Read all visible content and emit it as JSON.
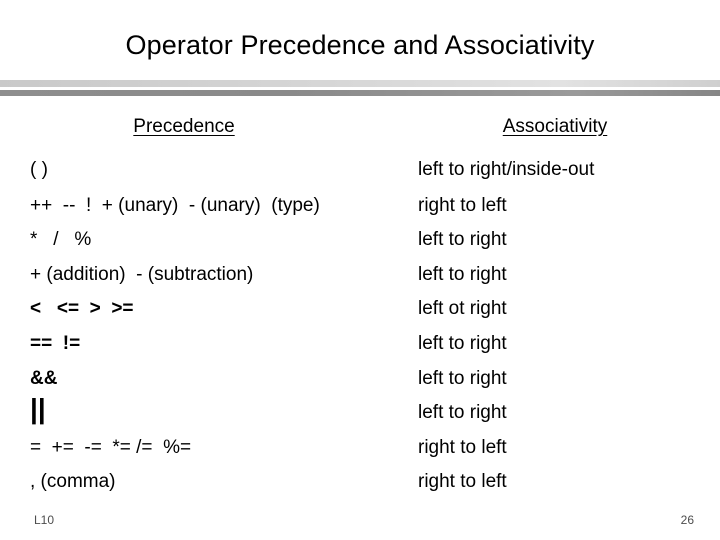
{
  "slide": {
    "title": "Operator Precedence and Associativity",
    "footer_label": "L10",
    "page_number": "26"
  },
  "table": {
    "headers": {
      "precedence": "Precedence",
      "associativity": "Associativity"
    },
    "rows": [
      {
        "precedence": "( )",
        "associativity": "left to right/inside-out",
        "style": "normal"
      },
      {
        "precedence": "++  --  !  + (unary)  - (unary)  (type)",
        "associativity": "right to left",
        "style": "normal"
      },
      {
        "precedence": "*   /   %",
        "associativity": "left to right",
        "style": "normal"
      },
      {
        "precedence": "+ (addition)  - (subtraction)",
        "associativity": "left to right",
        "style": "normal"
      },
      {
        "precedence": "<   <=  >  >=",
        "associativity": "left ot right",
        "style": "bold"
      },
      {
        "precedence": "==  !=",
        "associativity": "left to right",
        "style": "bold"
      },
      {
        "precedence": "&&",
        "associativity": "left to right",
        "style": "bold"
      },
      {
        "precedence": "||",
        "associativity": "left to right",
        "style": "bold-large"
      },
      {
        "precedence": "=  +=  -=  *= /=  %=",
        "associativity": "right to left",
        "style": "normal"
      },
      {
        "precedence": ", (comma)",
        "associativity": "right to left",
        "style": "normal"
      }
    ]
  },
  "colors": {
    "background": "#ffffff",
    "text": "#000000",
    "divider_light": "#d6d6d6",
    "divider_dark": "#8e8e8e",
    "footer_text": "#4d4d4d"
  }
}
